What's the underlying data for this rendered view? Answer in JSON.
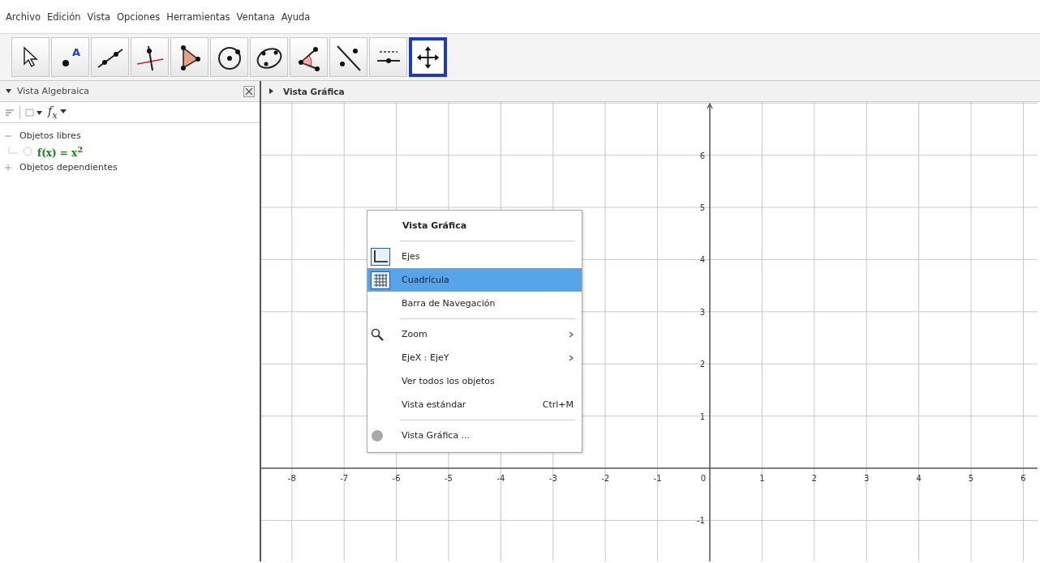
{
  "menubar": [
    "Archivo",
    "Edición",
    "Vista",
    "Opciones",
    "Herramientas",
    "Ventana",
    "Ayuda"
  ],
  "tools": [
    {
      "selected": false
    },
    {
      "selected": false,
      "icon_text": "A"
    },
    {
      "selected": false
    },
    {
      "selected": false
    },
    {
      "selected": false
    },
    {
      "selected": false
    },
    {
      "selected": false
    },
    {
      "selected": false
    },
    {
      "selected": false
    },
    {
      "selected": false
    },
    {
      "selected": true
    }
  ],
  "algebra_view": {
    "title": "Vista Algebraica",
    "expanded": true,
    "input_help": "f$_{x}$",
    "groups": [
      {
        "label": "Objetos libres",
        "expanded": true,
        "children": [
          {
            "label": "f(x) = x$^{2}$",
            "visible": false
          }
        ]
      },
      {
        "label": "Objetos dependientes",
        "expanded": false
      }
    ]
  },
  "graphics_view": {
    "title": "Vista Gráfica",
    "expanded": false,
    "x_labels": [
      "-8",
      "-7",
      "-6",
      "-5",
      "-4",
      "-3",
      "-2",
      "-1",
      "0",
      "1",
      "2",
      "3",
      "4",
      "5",
      "6"
    ],
    "y_labels": [
      "6",
      "5",
      "4",
      "3",
      "2",
      "1",
      "-1"
    ]
  },
  "context_menu": {
    "items": [
      {
        "kind": "header",
        "label": "Vista Gráfica"
      },
      {
        "kind": "separator"
      },
      {
        "kind": "axes-check",
        "label": "Ejes",
        "checked": true,
        "selected": false
      },
      {
        "kind": "grid-check",
        "label": "Cuadrícula",
        "checked": true,
        "selected": true
      },
      {
        "kind": "check",
        "label": "Barra de Navegación",
        "checked": false,
        "selected": false
      },
      {
        "kind": "separator"
      },
      {
        "kind": "zoom",
        "label": "Zoom",
        "selected": false
      },
      {
        "kind": "submenu",
        "label": "EjeX : EjeY",
        "selected": false
      },
      {
        "kind": "action",
        "label": "Ver todos los objetos",
        "selected": false
      },
      {
        "kind": "action",
        "label": "Vista estándar",
        "shortcut": "Ctrl+M",
        "selected": false
      },
      {
        "kind": "separator"
      },
      {
        "kind": "dialog",
        "label": "Vista Gráfica ...",
        "selected": false
      }
    ]
  }
}
